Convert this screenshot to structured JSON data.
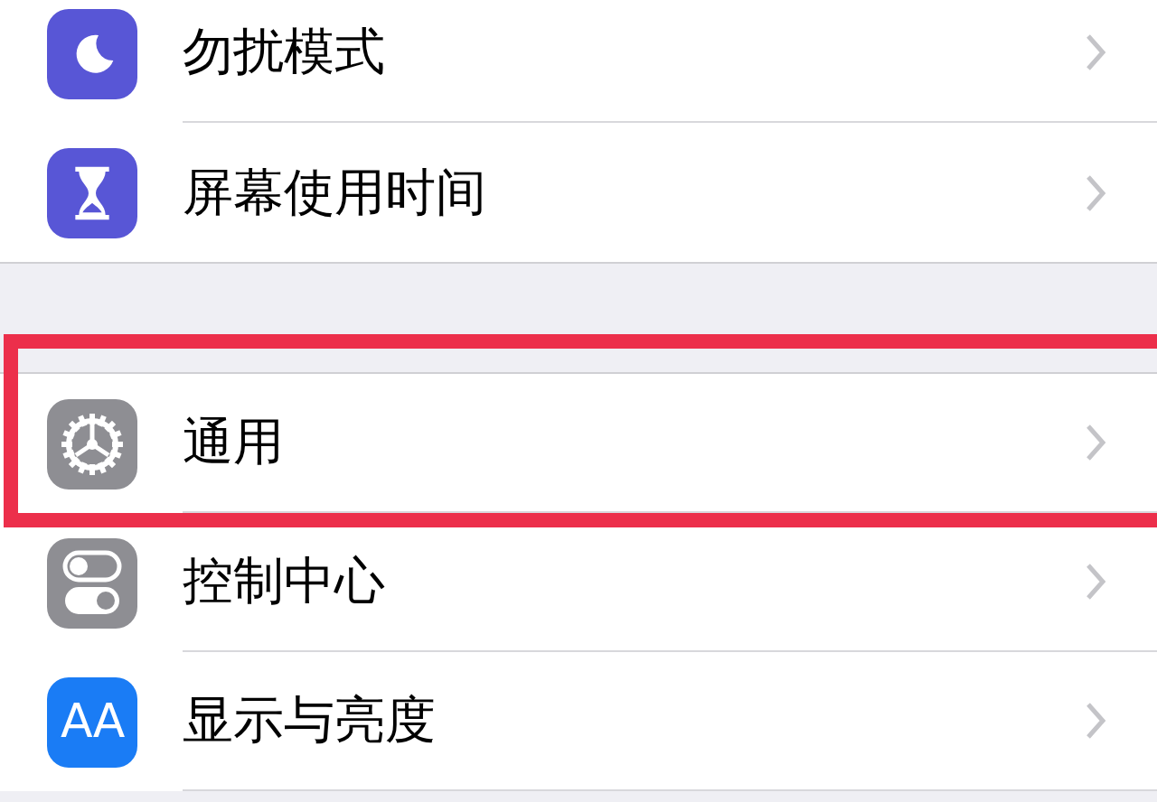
{
  "groups": [
    {
      "items": [
        {
          "label": "勿扰模式",
          "highlighted": false
        },
        {
          "label": "屏幕使用时间",
          "highlighted": false
        }
      ]
    },
    {
      "items": [
        {
          "label": "通用",
          "highlighted": true
        },
        {
          "label": "控制中心",
          "highlighted": false
        },
        {
          "label": "显示与亮度",
          "icon_text": "AA",
          "highlighted": false
        }
      ]
    }
  ]
}
